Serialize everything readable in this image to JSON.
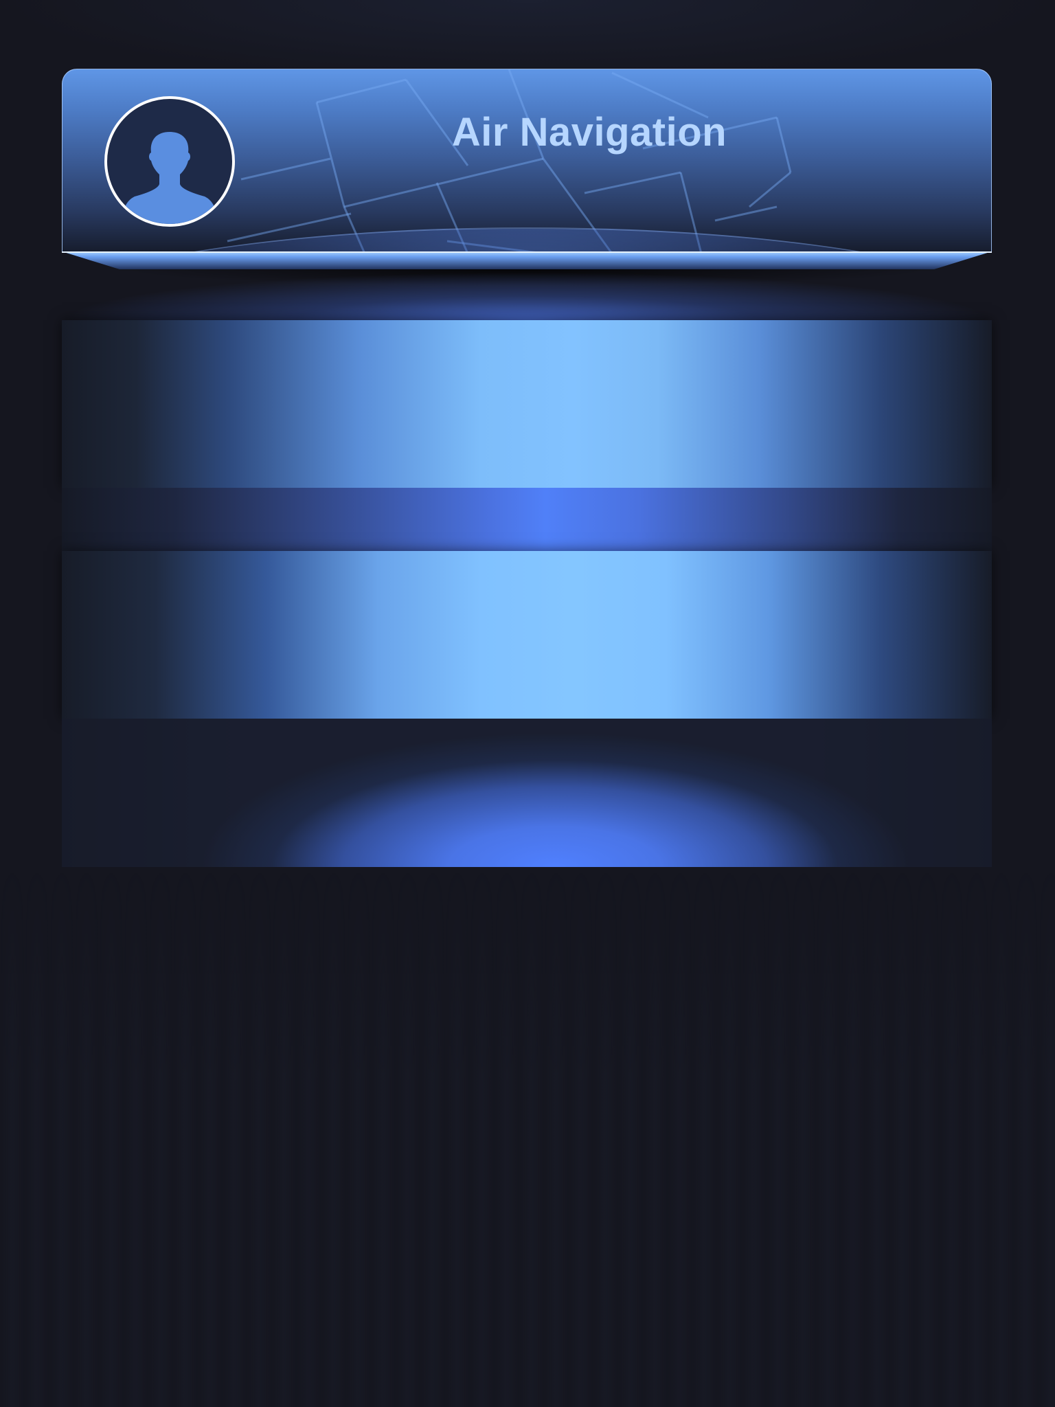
{
  "header": {
    "title": "Air Navigation",
    "avatar_icon": "user-silhouette-icon"
  },
  "colors": {
    "background": "#15161f",
    "accent_blue": "#5080f8",
    "light_blue": "#82c2ff",
    "title_text": "#b6d6ff"
  }
}
